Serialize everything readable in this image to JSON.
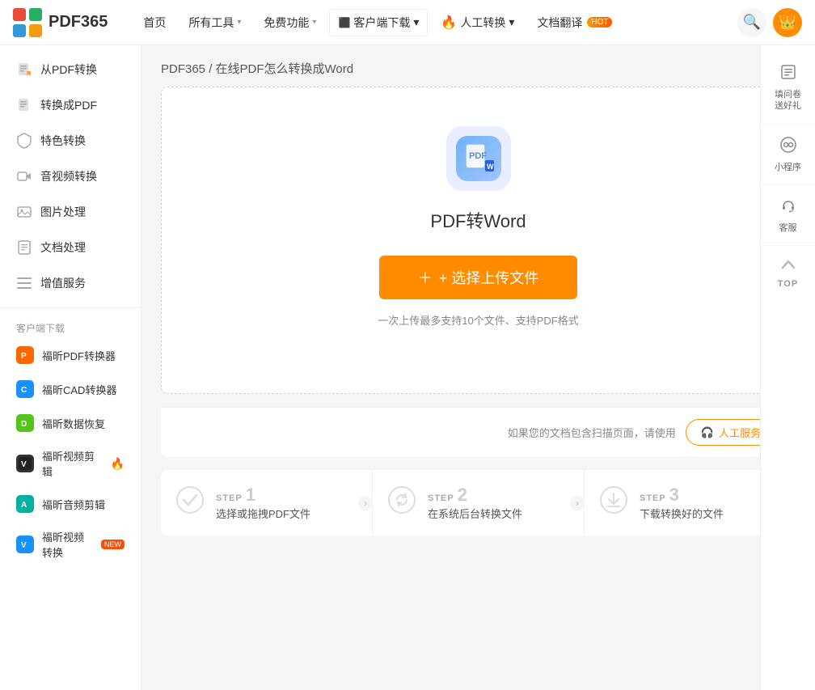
{
  "logo": {
    "text": "PDF365"
  },
  "nav": {
    "items": [
      {
        "label": "首页",
        "hasChevron": false
      },
      {
        "label": "所有工具",
        "hasChevron": true
      },
      {
        "label": "免费功能",
        "hasChevron": true
      },
      {
        "label": "客户端下载",
        "hasChevron": true
      },
      {
        "label": "人工转换",
        "hasChevron": true
      },
      {
        "label": "文档翻译",
        "hasChevron": false
      }
    ],
    "translate_badge": "HOT"
  },
  "sidebar": {
    "menu": [
      {
        "label": "从PDF转换",
        "icon": "📄"
      },
      {
        "label": "转换成PDF",
        "icon": "📑"
      },
      {
        "label": "特色转换",
        "icon": "🛡"
      },
      {
        "label": "音视频转换",
        "icon": "🎬"
      },
      {
        "label": "图片处理",
        "icon": "🖼"
      },
      {
        "label": "文档处理",
        "icon": "📝"
      },
      {
        "label": "增值服务",
        "icon": "☰"
      }
    ],
    "section_title": "客户端下载",
    "downloads": [
      {
        "label": "福昕PDF转换器",
        "icon": "🟠",
        "badge": ""
      },
      {
        "label": "福昕CAD转换器",
        "icon": "🔵",
        "badge": ""
      },
      {
        "label": "福昕数据恢复",
        "icon": "🟢",
        "badge": ""
      },
      {
        "label": "福昕视频剪辑",
        "icon": "🟤",
        "badge": "hot"
      },
      {
        "label": "福昕音频剪辑",
        "icon": "🟡",
        "badge": ""
      },
      {
        "label": "福昕视频转换",
        "icon": "🔵",
        "badge": "new"
      }
    ]
  },
  "breadcrumb": "PDF365 / 在线PDF怎么转换成Word",
  "main": {
    "tool_title": "PDF转Word",
    "upload_btn": "+ 选择上传文件",
    "upload_hint": "一次上传最多支持10个文件、支持PDF格式",
    "manual_hint": "如果您的文档包含扫描页面，请使用",
    "manual_btn": "🎧 人工服务"
  },
  "steps": [
    {
      "step": "STEP",
      "num": "1",
      "desc": "选择或拖拽PDF文件"
    },
    {
      "step": "STEP",
      "num": "2",
      "desc": "在系统后台转换文件"
    },
    {
      "step": "STEP",
      "num": "3",
      "desc": "下载转换好的文件"
    }
  ],
  "right_panel": [
    {
      "icon": "📋",
      "label": "填问卷\n送好礼"
    },
    {
      "icon": "⚙",
      "label": "小程序"
    },
    {
      "icon": "🎧",
      "label": "客服"
    }
  ],
  "top_btn": {
    "label": "TOP"
  }
}
